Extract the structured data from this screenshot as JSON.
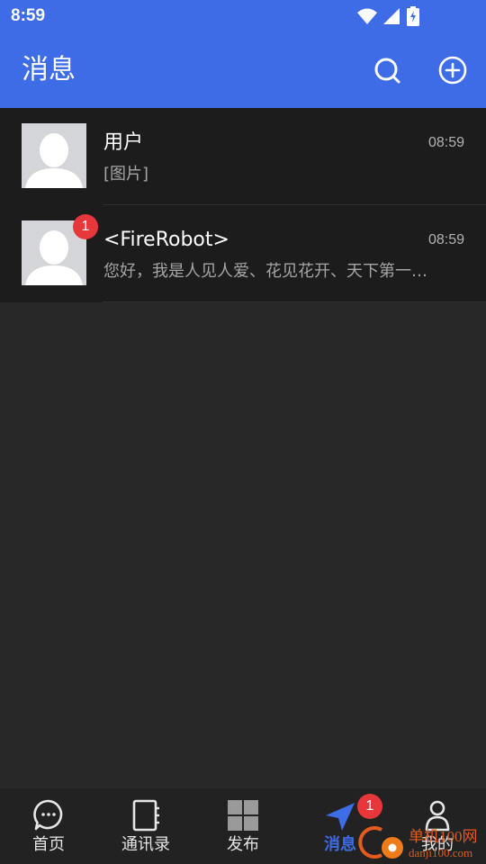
{
  "status_bar": {
    "time": "8:59",
    "icons": [
      "wifi-icon",
      "signal-icon",
      "battery-charging-icon"
    ]
  },
  "app_bar": {
    "title": "消息",
    "actions": [
      "search-icon",
      "add-circle-icon"
    ]
  },
  "conversations": [
    {
      "name": "用户",
      "time": "08:59",
      "preview": "[图片]",
      "unread": null
    },
    {
      "name": "<FireRobot>",
      "time": "08:59",
      "preview": "您好，我是人见人爱、花见花开、天下第一…",
      "unread": "1"
    }
  ],
  "bottom_nav": {
    "items": [
      {
        "label": "首页",
        "icon": "chat-bubble-icon",
        "active": false
      },
      {
        "label": "通讯录",
        "icon": "contacts-book-icon",
        "active": false
      },
      {
        "label": "发布",
        "icon": "grid-icon",
        "active": false
      },
      {
        "label": "消息",
        "icon": "navigation-arrow-icon",
        "active": true,
        "badge": "1"
      },
      {
        "label": "我的",
        "icon": "person-icon",
        "active": false
      }
    ]
  },
  "watermark": {
    "line1": "单机100网",
    "line2": "danji100.com"
  },
  "colors": {
    "primary": "#3d6ce6",
    "background": "#282828",
    "list_item": "#1c1c1c",
    "badge": "#e8373a",
    "nav_background": "#222222"
  }
}
